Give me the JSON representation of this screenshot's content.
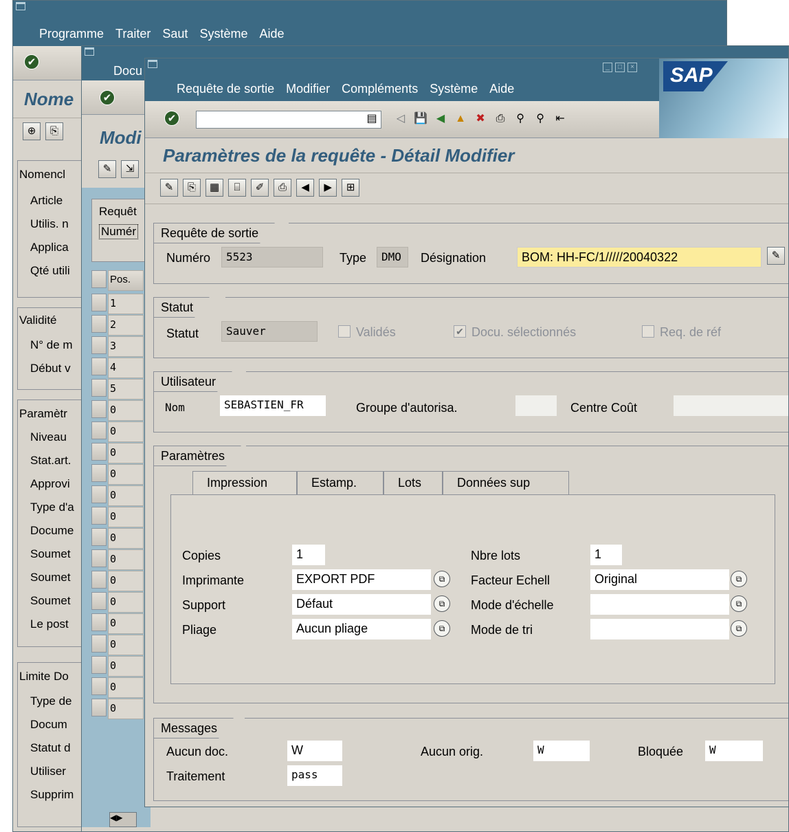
{
  "back_window_1": {
    "menu": [
      "Programme",
      "Traiter",
      "Saut",
      "Système",
      "Aide"
    ],
    "title_partial": "Nome",
    "sections": [
      {
        "title": "Nomencl",
        "rows": [
          "Article",
          "Utilis. n",
          "Applica",
          "Qté utili"
        ]
      },
      {
        "title": "Validité",
        "rows": [
          "N° de m",
          "Début v"
        ]
      },
      {
        "title": "Paramètr",
        "rows": [
          "Niveau",
          "Stat.art.",
          "Approvi",
          "Type d'a",
          "Docume",
          "Soumet",
          "Soumet",
          "Soumet",
          "Le post"
        ]
      },
      {
        "title": "Limite Do",
        "rows": [
          "Type de",
          "Docum",
          "Statut d",
          "Utiliser",
          "Supprim"
        ]
      }
    ]
  },
  "back_window_2": {
    "menu_partial": "Docu",
    "title_partial": "Modi",
    "group_title": "Requêt",
    "group_field": "Numér",
    "grid_header": "Pos.",
    "grid_rows": [
      "1",
      "2",
      "3",
      "4",
      "5",
      "0",
      "0",
      "0",
      "0",
      "0",
      "0",
      "0",
      "0",
      "0",
      "0",
      "0",
      "0",
      "0",
      "0",
      "0"
    ]
  },
  "main": {
    "menu": [
      "Requête de sortie",
      "Modifier",
      "Compléments",
      "Système",
      "Aide"
    ],
    "logo_text": "SAP",
    "title": "Paramètres de la requête - Détail Modifier",
    "request": {
      "group": "Requête de sortie",
      "numero_label": "Numéro",
      "numero": "5523",
      "type_label": "Type",
      "type": "DMO",
      "designation_label": "Désignation",
      "designation": "BOM: HH-FC/1/////20040322"
    },
    "status": {
      "group": "Statut",
      "label": "Statut",
      "value": "Sauver",
      "checkboxes": [
        {
          "label": "Validés",
          "checked": false
        },
        {
          "label": "Docu. sélectionnés",
          "checked": true
        },
        {
          "label": "Req. de réf",
          "checked": false
        }
      ]
    },
    "user": {
      "group": "Utilisateur",
      "nom_label": "Nom",
      "nom": "SEBASTIEN_FR",
      "auth_label": "Groupe d'autorisa.",
      "auth": "",
      "cost_label": "Centre Coût",
      "cost": ""
    },
    "params": {
      "group": "Paramètres",
      "tabs": [
        "Impression",
        "Estamp.",
        "Lots",
        "Données sup"
      ],
      "active_tab": "Impression",
      "left": [
        {
          "label": "Copies",
          "value": "1"
        },
        {
          "label": "Imprimante",
          "value": "EXPORT PDF"
        },
        {
          "label": "Support",
          "value": "Défaut"
        },
        {
          "label": "Pliage",
          "value": "Aucun pliage"
        }
      ],
      "right": [
        {
          "label": "Nbre lots",
          "value": "1"
        },
        {
          "label": "Facteur Echell",
          "value": "Original"
        },
        {
          "label": "Mode d'échelle",
          "value": ""
        },
        {
          "label": "Mode de tri",
          "value": ""
        }
      ]
    },
    "messages": {
      "group": "Messages",
      "no_doc_label": "Aucun doc.",
      "no_doc": "W",
      "no_orig_label": "Aucun orig.",
      "no_orig": "W",
      "blocked_label": "Bloquée",
      "blocked": "W",
      "process_label": "Traitement",
      "process": "pass"
    }
  },
  "colors": {
    "title_text": "#335e7e",
    "titlebar": "#3c6a84",
    "highlight_field": "#fcec9c"
  }
}
